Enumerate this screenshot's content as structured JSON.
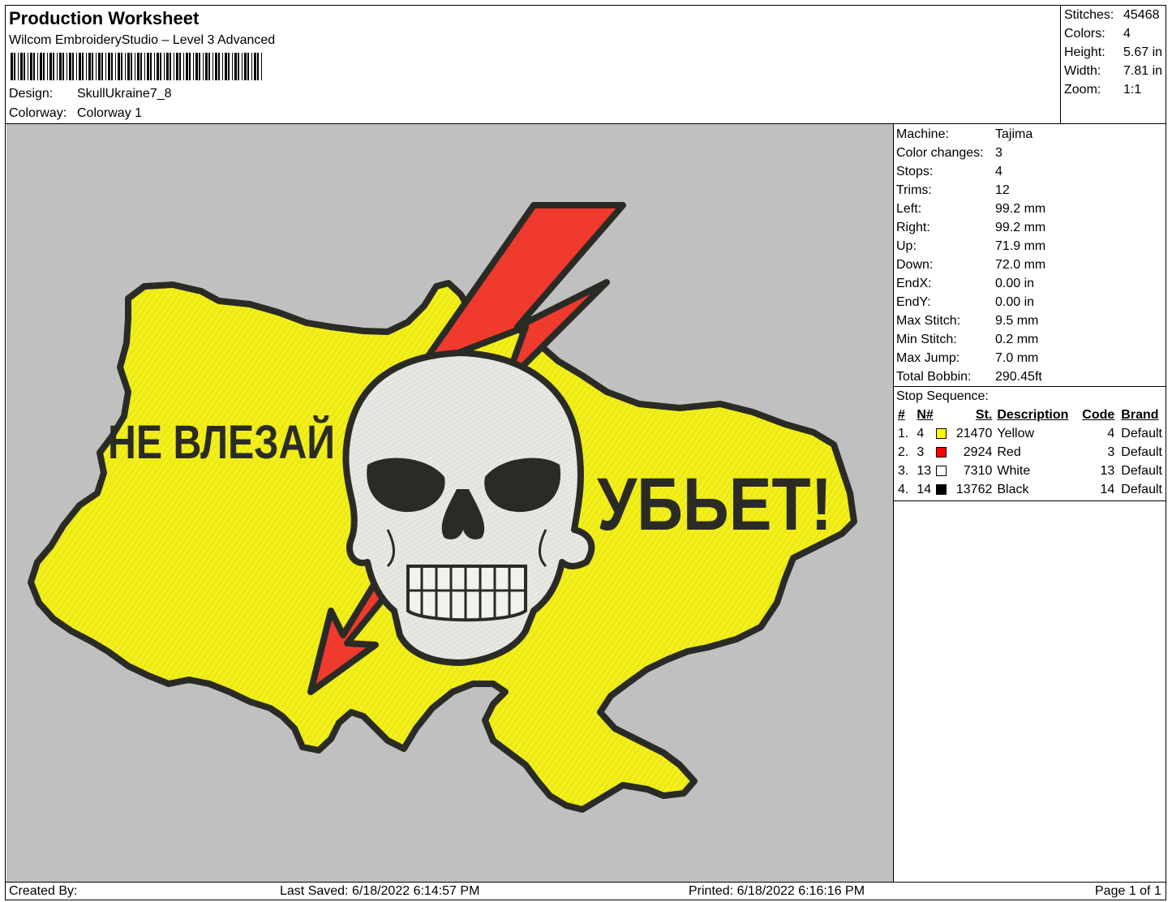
{
  "header": {
    "title": "Production Worksheet",
    "software": "Wilcom EmbroideryStudio – Level 3 Advanced",
    "design_label": "Design:",
    "design_value": "SkullUkraine7_8",
    "colorway_label": "Colorway:",
    "colorway_value": "Colorway 1"
  },
  "summary": {
    "stitches_label": "Stitches:",
    "stitches_value": "45468",
    "colors_label": "Colors:",
    "colors_value": "4",
    "height_label": "Height:",
    "height_value": "5.67 in",
    "width_label": "Width:",
    "width_value": "7.81 in",
    "zoom_label": "Zoom:",
    "zoom_value": "1:1"
  },
  "design_text": {
    "line1": "НЕ ВЛЕЗАЙ",
    "line2": "УБЬЕТ!"
  },
  "machine_info": [
    {
      "label": "Machine:",
      "value": "Tajima"
    },
    {
      "label": "Color changes:",
      "value": "3"
    },
    {
      "label": "Stops:",
      "value": "4"
    },
    {
      "label": "Trims:",
      "value": "12"
    },
    {
      "label": "Left:",
      "value": "99.2 mm"
    },
    {
      "label": "Right:",
      "value": "99.2 mm"
    },
    {
      "label": "Up:",
      "value": "71.9 mm"
    },
    {
      "label": "Down:",
      "value": "72.0 mm"
    },
    {
      "label": "EndX:",
      "value": "0.00 in"
    },
    {
      "label": "EndY:",
      "value": "0.00 in"
    },
    {
      "label": "Max Stitch:",
      "value": "9.5 mm"
    },
    {
      "label": "Min Stitch:",
      "value": "0.2 mm"
    },
    {
      "label": "Max Jump:",
      "value": "7.0 mm"
    },
    {
      "label": "Total Bobbin:",
      "value": "290.45ft"
    }
  ],
  "stop_sequence": {
    "heading": "Stop Sequence:",
    "columns": {
      "idx": "#",
      "n": "N#",
      "st": "St.",
      "desc": "Description",
      "code": "Code",
      "brand": "Brand"
    },
    "rows": [
      {
        "idx": "1.",
        "n": "4",
        "color": "#ffff00",
        "st": "21470",
        "desc": "Yellow",
        "code": "4",
        "brand": "Default"
      },
      {
        "idx": "2.",
        "n": "3",
        "color": "#ff0000",
        "st": "2924",
        "desc": "Red",
        "code": "3",
        "brand": "Default"
      },
      {
        "idx": "3.",
        "n": "13",
        "color": "#ffffff",
        "st": "7310",
        "desc": "White",
        "code": "13",
        "brand": "Default"
      },
      {
        "idx": "4.",
        "n": "14",
        "color": "#000000",
        "st": "13762",
        "desc": "Black",
        "code": "14",
        "brand": "Default"
      }
    ]
  },
  "footer": {
    "created_by": "Created By:",
    "last_saved": "Last Saved: 6/18/2022 6:14:57 PM",
    "printed": "Printed: 6/18/2022 6:16:16 PM",
    "page": "Page 1 of 1"
  },
  "colors": {
    "preview_bg": "#c0c0c0",
    "yellow": "#f2ef1a",
    "red": "#f03a2e",
    "outline": "#2b2b26",
    "skull": "#e6e6e0"
  }
}
